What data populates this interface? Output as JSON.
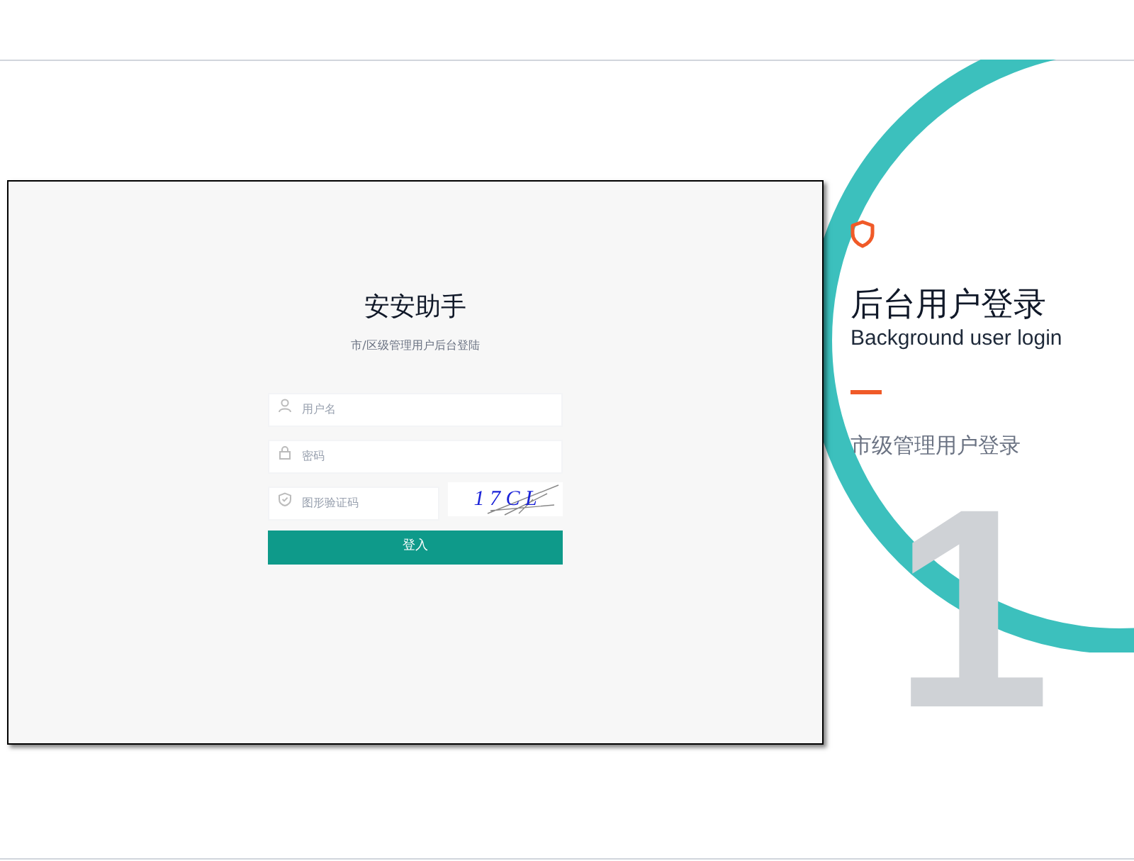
{
  "login_panel": {
    "title": "安安助手",
    "subtitle": "市/区级管理用户后台登陆",
    "fields": [
      {
        "kind": "user",
        "placeholder": "用户名"
      },
      {
        "kind": "lock",
        "placeholder": "密码"
      }
    ],
    "captcha": {
      "placeholder": "图形验证码",
      "image_text": "1 7 C L"
    },
    "submit": "登入"
  },
  "side": {
    "heading": "后台用户登录",
    "subheading": "Background user login",
    "caption": "市级管理用户登录",
    "big_number": "1"
  }
}
